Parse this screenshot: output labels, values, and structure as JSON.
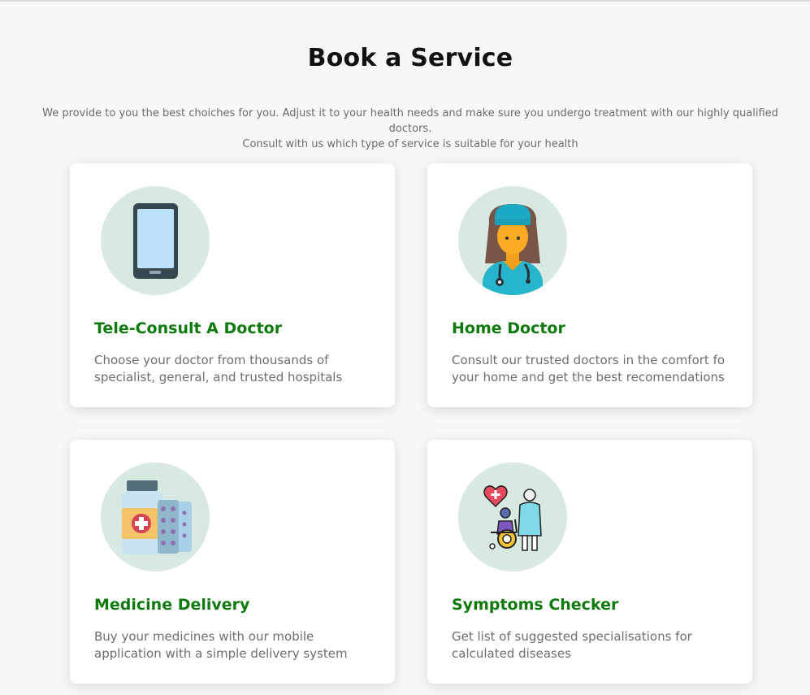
{
  "header": {
    "title": "Book a Service",
    "subtitle_line1": "We provide to you the best choiches for you. Adjust it to your health needs and make sure you undergo treatment with our highly qualified doctors.",
    "subtitle_line2": "Consult with us which type of service is suitable for your health"
  },
  "services": [
    {
      "title": "Tele-Consult A Doctor",
      "description": "Choose your doctor from thousands of specialist, general, and trusted hospitals",
      "icon": "smartphone-icon"
    },
    {
      "title": "Home Doctor",
      "description": "Consult our trusted doctors in the comfort fo your home and get the best recomendations",
      "icon": "doctor-icon"
    },
    {
      "title": "Medicine Delivery",
      "description": "Buy your medicines with our mobile application with a simple delivery system",
      "icon": "medicine-icon"
    },
    {
      "title": "Symptoms Checker",
      "description": "Get list of suggested specialisations for calculated diseases",
      "icon": "patient-care-icon"
    }
  ],
  "colors": {
    "background": "#f6f8f7",
    "accent_title": "#0e7a0e",
    "icon_circle": "#d7e9e0",
    "text_muted": "#6e6e6e"
  }
}
